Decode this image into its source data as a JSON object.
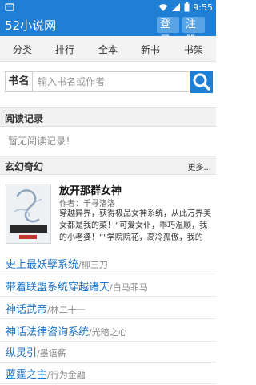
{
  "status_bar": {
    "time": "9:55"
  },
  "header": {
    "title": "52小说网",
    "login_label": "登录",
    "register_label": "注册"
  },
  "nav": {
    "items": [
      "分类",
      "排行",
      "全本",
      "新书",
      "书架"
    ]
  },
  "search": {
    "label": "书名",
    "placeholder": "输入书名或作者"
  },
  "reading_record": {
    "title": "阅读记录",
    "empty_text": "暂无阅读记录！"
  },
  "xuanhuan": {
    "title": "玄幻奇幻",
    "more_label": "更多...",
    "featured": {
      "title": "放开那群女神",
      "author": "作者：千寻洛洛",
      "description": "穿越异界，获得极品女神系统，从此万界美女都是我的菜！“可爱女仆，乖巧温顺，我的小老婆！”\"学院院花，高冷孤傲，我的",
      "cover_title": "放开那群女神"
    },
    "books": [
      {
        "title": "史上最妖孽系统",
        "author": "/柳三刀"
      },
      {
        "title": "带着联盟系统穿越诸天",
        "author": "/白马菲马"
      },
      {
        "title": "神话武帝",
        "author": "/林二十一"
      },
      {
        "title": "神话法律咨询系统",
        "author": "/光暗之心"
      },
      {
        "title": "纵灵引",
        "author": "/墨语薪"
      },
      {
        "title": "蓝霆之主",
        "author": "/行为金融"
      }
    ]
  },
  "colors": {
    "brand": "#1f7fd4",
    "link": "#1a73c8"
  }
}
